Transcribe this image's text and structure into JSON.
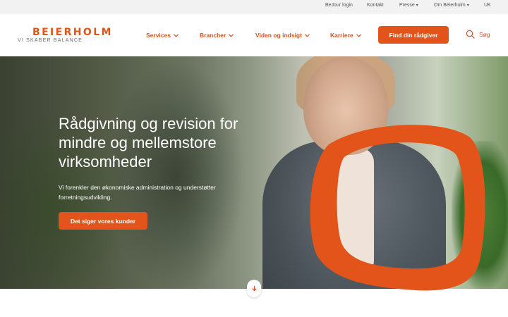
{
  "topbar": {
    "links": [
      {
        "label": "BeJour login"
      },
      {
        "label": "Kontakt"
      },
      {
        "label": "Presse"
      },
      {
        "label": "Om Beierholm"
      },
      {
        "label": "UK"
      }
    ]
  },
  "brand": {
    "name": "BEIERHOLM",
    "tagline": "VI SKABER BALANCE",
    "accent_color": "#e3541a"
  },
  "nav": {
    "items": [
      {
        "label": "Services"
      },
      {
        "label": "Brancher"
      },
      {
        "label": "Viden og indsigt"
      },
      {
        "label": "Karriere"
      }
    ],
    "cta_label": "Find din rådgiver",
    "search_label": "Søg"
  },
  "hero": {
    "title": "Rådgivning og revision for mindre og mellemstore virksomheder",
    "subtitle": "Vi forenkler den økonomiske administration og understøtter forretningsudvikling.",
    "button_label": "Det siger vores kunder"
  },
  "icons": {
    "chevron": "chevron-down-icon",
    "search": "search-icon",
    "scroll": "arrow-down-icon"
  }
}
